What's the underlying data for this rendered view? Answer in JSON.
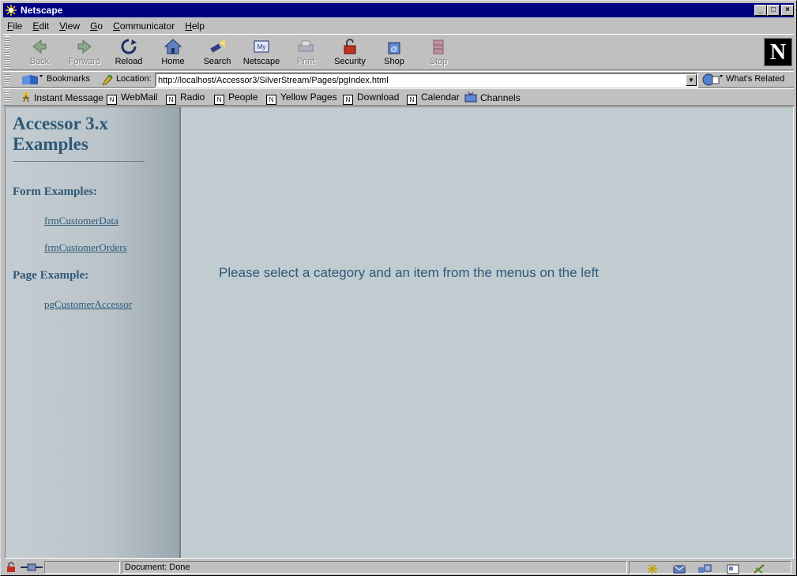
{
  "window": {
    "title": "Netscape"
  },
  "menu": [
    {
      "label": "File",
      "accel": "F",
      "rest": "ile"
    },
    {
      "label": "Edit",
      "accel": "E",
      "rest": "dit"
    },
    {
      "label": "View",
      "accel": "V",
      "rest": "iew"
    },
    {
      "label": "Go",
      "accel": "G",
      "rest": "o"
    },
    {
      "label": "Communicator",
      "accel": "C",
      "rest": "ommunicator"
    },
    {
      "label": "Help",
      "accel": "H",
      "rest": "elp"
    }
  ],
  "nav_toolbar": {
    "back": "Back",
    "forward": "Forward",
    "reload": "Reload",
    "home": "Home",
    "search": "Search",
    "netscape": "Netscape",
    "print": "Print",
    "security": "Security",
    "shop": "Shop",
    "stop": "Stop",
    "logo": "N"
  },
  "location_toolbar": {
    "bookmarks": "Bookmarks",
    "location_label": "Location:",
    "url": "http://localhost/Accessor3/SilverStream/Pages/pgIndex.html",
    "whats_related": "What's Related"
  },
  "personal_toolbar": {
    "instant_message": "Instant Message",
    "webmail": "WebMail",
    "radio": "Radio",
    "people": "People",
    "yellow_pages": "Yellow Pages",
    "download": "Download",
    "calendar": "Calendar",
    "channels": "Channels"
  },
  "sidebar": {
    "title": "Accessor 3.x Examples",
    "form_heading": "Form Examples:",
    "form_links": [
      "frmCustomerData ",
      "frmCustomerOrders"
    ],
    "page_heading": "Page Example:",
    "page_links": [
      "pgCustomerAccessor"
    ]
  },
  "main": {
    "message": "Please select a category and an item from the menus on the left"
  },
  "status": {
    "text": "Document: Done"
  },
  "colors": {
    "title_bar": "#000080",
    "link_text": "#2e5878",
    "main_bg": "#c1ccd1"
  }
}
